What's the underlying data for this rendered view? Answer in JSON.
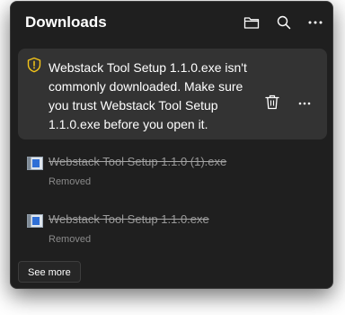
{
  "header": {
    "title": "Downloads",
    "icons": [
      "folder-icon",
      "search-icon",
      "more-options-icon"
    ]
  },
  "warning": {
    "icon": "shield-warning-icon",
    "message": "Webstack Tool Setup 1.1.0.exe isn't commonly downloaded. Make sure you trust Webstack Tool Setup 1.1.0.exe before you open it.",
    "actions": [
      "delete-icon",
      "more-options-icon"
    ]
  },
  "downloads": [
    {
      "name": "Webstack Tool Setup 1.1.0 (1).exe",
      "status": "Removed",
      "icon": "installer-file-icon"
    },
    {
      "name": "Webstack Tool Setup 1.1.0.exe",
      "status": "Removed",
      "icon": "installer-file-icon"
    }
  ],
  "footer": {
    "see_more_label": "See more"
  },
  "colors": {
    "panel_background": "#1f1f1f",
    "card_background": "#333333",
    "warning_accent": "#f5c518",
    "file_icon_blue": "#2f6fd6"
  }
}
